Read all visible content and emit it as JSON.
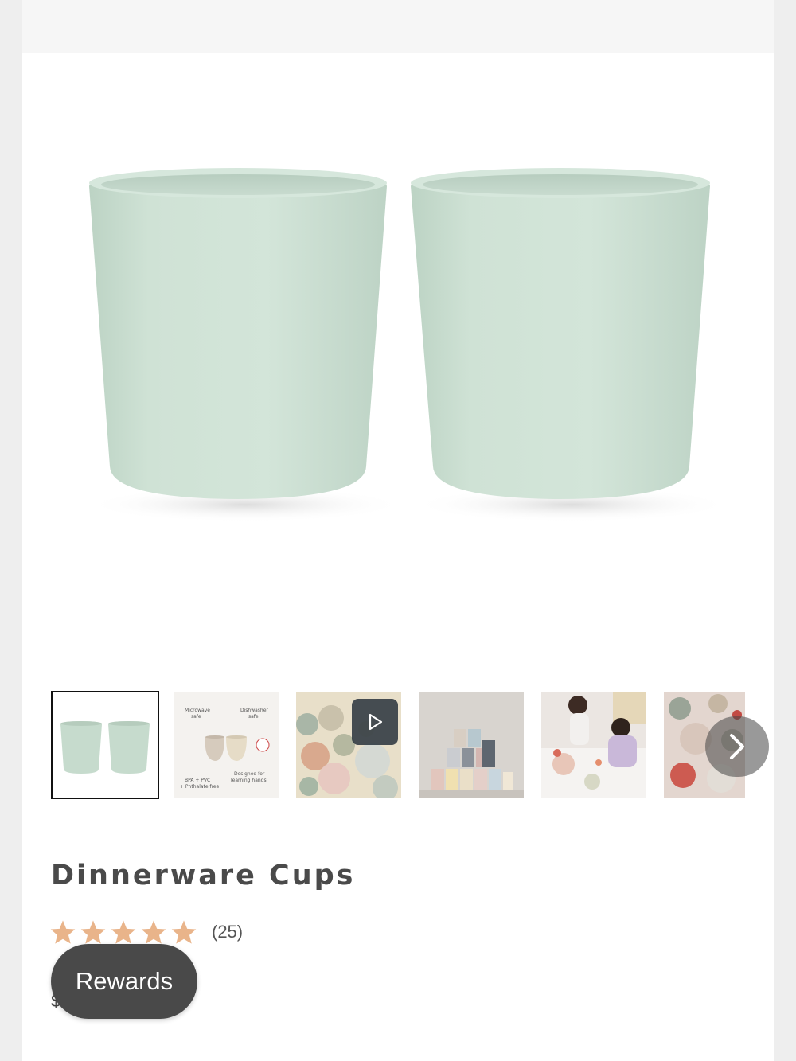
{
  "product": {
    "title": "Dinnerware Cups",
    "rating_stars": 5,
    "review_count": "(25)",
    "price_partial": "$"
  },
  "gallery": {
    "main_image": "two-sage-green-cups",
    "thumbnails": [
      {
        "name": "two-sage-cups",
        "active": true
      },
      {
        "name": "features-diagram",
        "labels": [
          "Microwave safe",
          "Dishwasher safe",
          "BPA + PVC + Phthalate free",
          "Designed for learning hands"
        ]
      },
      {
        "name": "dinnerware-flatlay-video",
        "has_play_icon": true
      },
      {
        "name": "stacked-cups-tower"
      },
      {
        "name": "children-eating"
      },
      {
        "name": "table-setting-partial"
      }
    ],
    "next_icon": "chevron-right-icon",
    "play_icon": "play-icon"
  },
  "floating": {
    "rewards_label": "Rewards"
  },
  "colors": {
    "cup_sage": "#c9ddd0",
    "star": "#e9b48a",
    "rewards_bg": "#494949",
    "title_text": "#4a4a4a"
  }
}
